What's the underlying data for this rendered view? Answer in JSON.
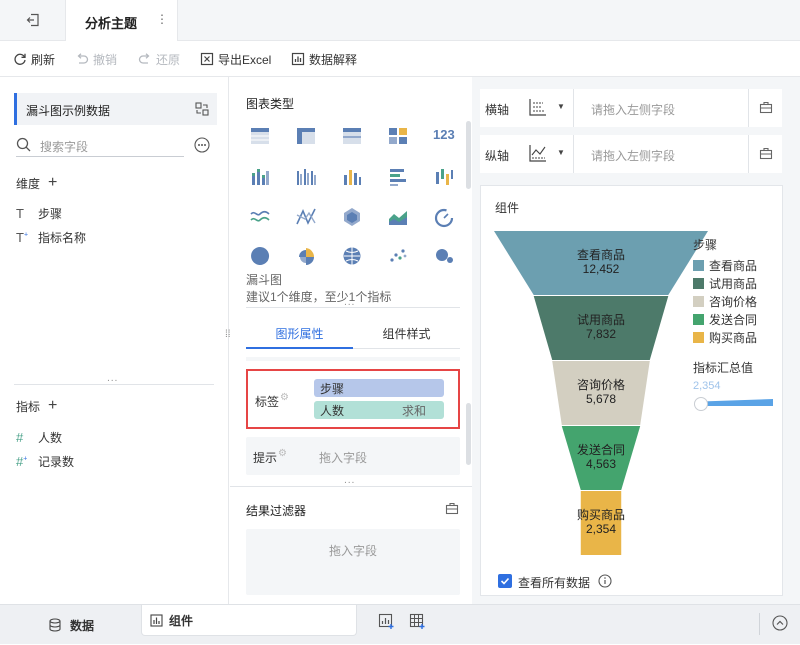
{
  "topbar": {
    "tab_title": "分析主题"
  },
  "toolbar": {
    "refresh": "刷新",
    "undo": "撤销",
    "redo": "还原",
    "export_excel": "导出Excel",
    "data_explain": "数据解释"
  },
  "left": {
    "dataset_title": "漏斗图示例数据",
    "search_placeholder": "搜索字段",
    "dimension_header": "维度",
    "dimensions": [
      "步骤",
      "指标名称"
    ],
    "measure_header": "指标",
    "measures": [
      "人数",
      "记录数"
    ]
  },
  "middle": {
    "chart_type_title": "图表类型",
    "chart_name": "漏斗图",
    "chart_hint": "建议1个维度，至少1个指标",
    "tabs": [
      "图形属性",
      "组件样式"
    ],
    "label_section": "标签",
    "label_pills": [
      "步骤",
      "人数"
    ],
    "label_agg": "求和",
    "tooltip_section": "提示",
    "tooltip_placeholder": "拖入字段",
    "filter_title": "结果过滤器",
    "filter_placeholder": "拖入字段"
  },
  "right": {
    "x_axis_label": "横轴",
    "x_axis_placeholder": "请拖入左侧字段",
    "y_axis_label": "纵轴",
    "y_axis_placeholder": "请拖入左侧字段",
    "component_title": "组件",
    "legend_title": "步骤",
    "size_legend_title": "指标汇总值",
    "size_legend_value": "2,354",
    "show_all_data": "查看所有数据"
  },
  "chart_data": {
    "type": "funnel",
    "categories": [
      "查看商品",
      "试用商品",
      "咨询价格",
      "发送合同",
      "购买商品"
    ],
    "values": [
      12452,
      7832,
      5678,
      4563,
      2354
    ],
    "value_labels": [
      "12,452",
      "7,832",
      "5,678",
      "4,563",
      "2,354"
    ],
    "colors": [
      "#6c9fb0",
      "#4d7a6a",
      "#d3cfc1",
      "#44a46e",
      "#e9b548"
    ],
    "legend": "right",
    "title": ""
  },
  "bottombar": {
    "data_tab": "数据",
    "component_tab": "组件"
  },
  "colors": {
    "accent": "#2f6fe0",
    "frame_red": "#e64545",
    "pill_blue": "#b6c7ea",
    "pill_green": "#b2e0d7"
  }
}
